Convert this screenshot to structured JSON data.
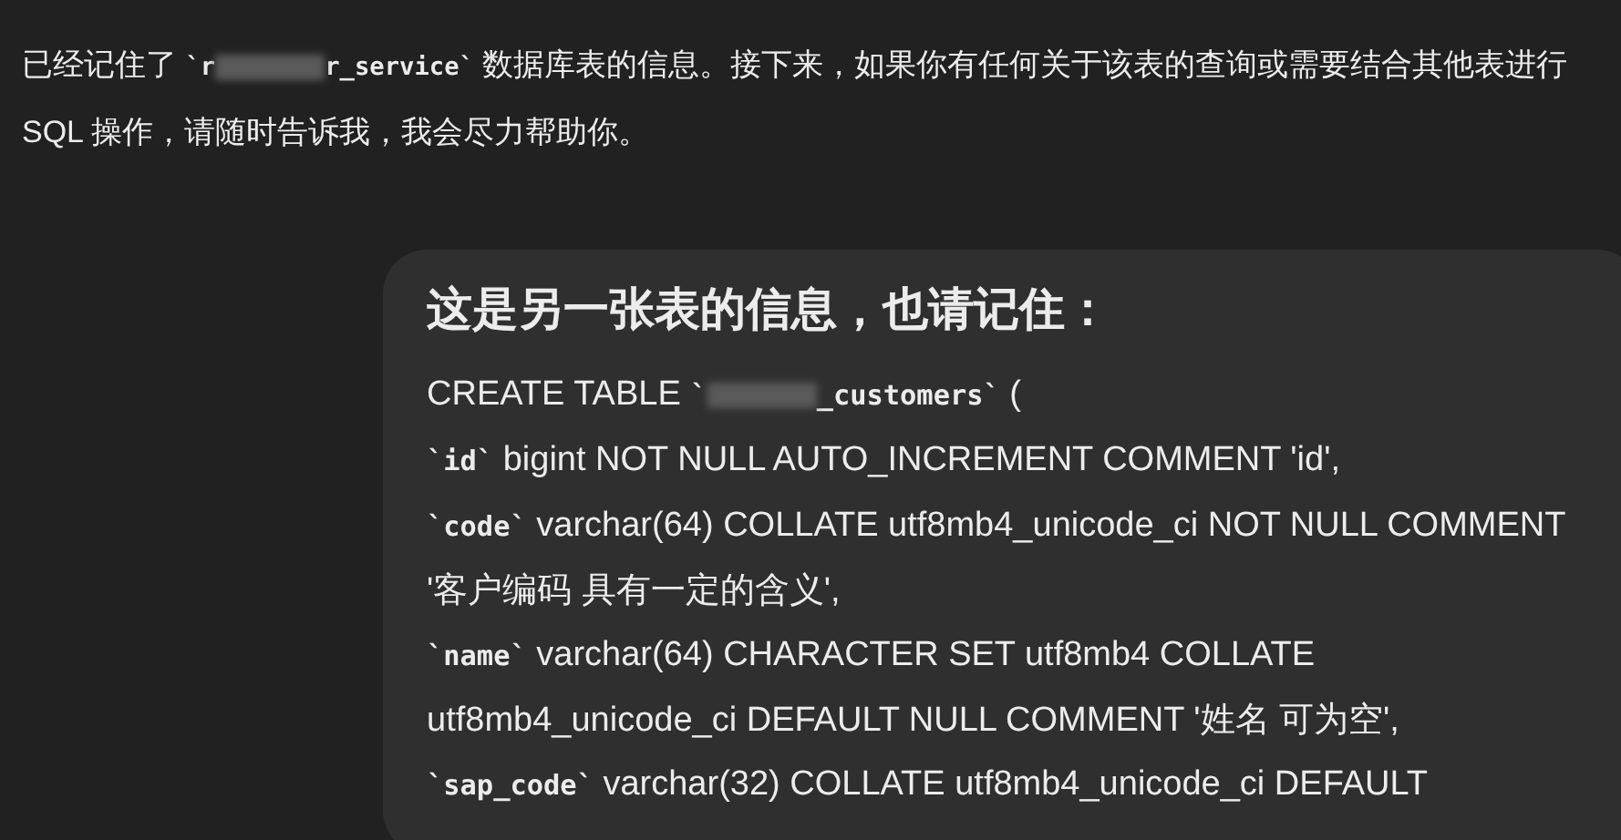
{
  "assistant_message": {
    "segments": [
      {
        "kind": "text",
        "text": "已经记住了 "
      },
      {
        "kind": "code",
        "text": "`r"
      },
      {
        "kind": "redacted"
      },
      {
        "kind": "code",
        "text": "r_service`"
      },
      {
        "kind": "text",
        "text": " 数据库表的信息。接下来，如果你有任何关于该表的查询或需要结合其他表进行 SQL 操作，请随时告诉我，我会尽力帮助你。"
      }
    ]
  },
  "user_message": {
    "heading": "这是另一张表的信息，也请记住：",
    "lines": [
      [
        {
          "kind": "text",
          "text": "CREATE TABLE "
        },
        {
          "kind": "code",
          "text": "`"
        },
        {
          "kind": "redacted"
        },
        {
          "kind": "code",
          "text": "_customers`"
        },
        {
          "kind": "text",
          "text": " ("
        }
      ],
      [
        {
          "kind": "code",
          "text": "`id`"
        },
        {
          "kind": "text",
          "text": " bigint NOT NULL AUTO_INCREMENT COMMENT 'id',"
        }
      ],
      [
        {
          "kind": "code",
          "text": "`code`"
        },
        {
          "kind": "text",
          "text": " varchar(64) COLLATE utf8mb4_unicode_ci NOT NULL COMMENT '客户编码 具有一定的含义',"
        }
      ],
      [
        {
          "kind": "code",
          "text": "`name`"
        },
        {
          "kind": "text",
          "text": " varchar(64) CHARACTER SET utf8mb4 COLLATE utf8mb4_unicode_ci DEFAULT NULL COMMENT '姓名 可为空',"
        }
      ],
      [
        {
          "kind": "code",
          "text": "`sap_code`"
        },
        {
          "kind": "text",
          "text": " varchar(32) COLLATE utf8mb4_unicode_ci DEFAULT"
        }
      ]
    ]
  }
}
